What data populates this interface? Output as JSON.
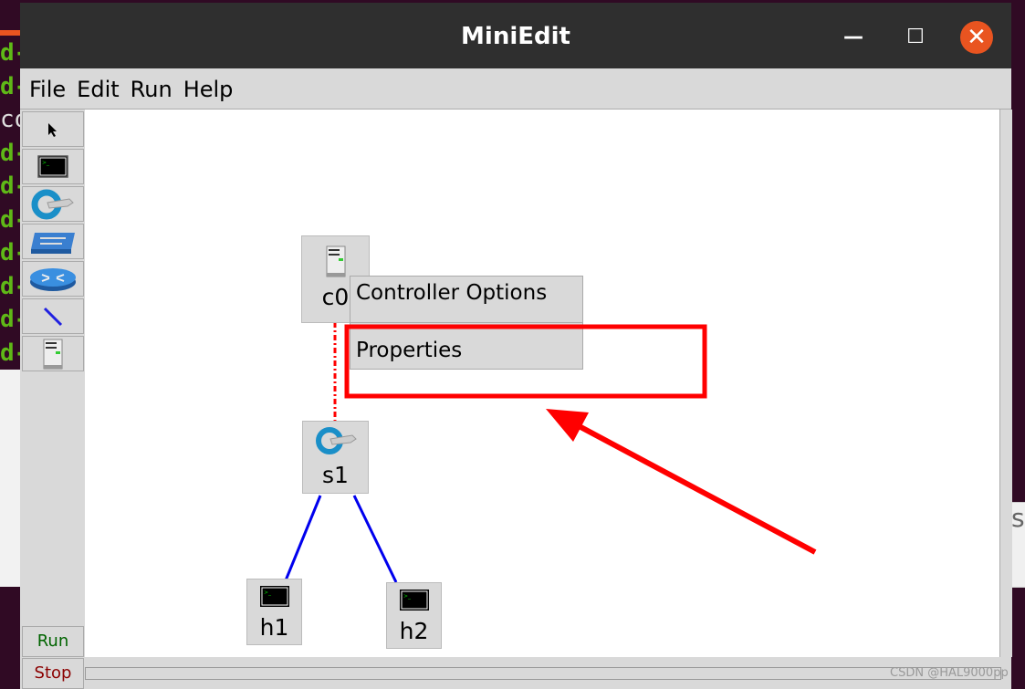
{
  "background": {
    "terminal_lines": [
      "d-",
      "d-",
      "co",
      "d-",
      "d-",
      "d-",
      "d-",
      "d-",
      "d-",
      "d-",
      "co"
    ],
    "right_panel_text": "st"
  },
  "window": {
    "title": "MiniEdit",
    "minimize": "—",
    "maximize": "☐",
    "close": "✕"
  },
  "menu": [
    "File",
    "Edit",
    "Run",
    "Help"
  ],
  "toolbar": {
    "tools": [
      "select-icon",
      "host-icon",
      "switch-icon",
      "legacy-switch-icon",
      "legacy-router-icon",
      "link-icon",
      "controller-icon"
    ],
    "run": "Run",
    "stop": "Stop",
    "run_color": "#006400",
    "stop_color": "#8b0000"
  },
  "nodes": {
    "c0": "c0",
    "s1": "s1",
    "h1": "h1",
    "h2": "h2"
  },
  "context_menu": {
    "items": [
      "Controller Options",
      "Properties"
    ]
  },
  "annotation": {
    "color": "#ff0000"
  },
  "watermark": "CSDN @HAL9000pp"
}
